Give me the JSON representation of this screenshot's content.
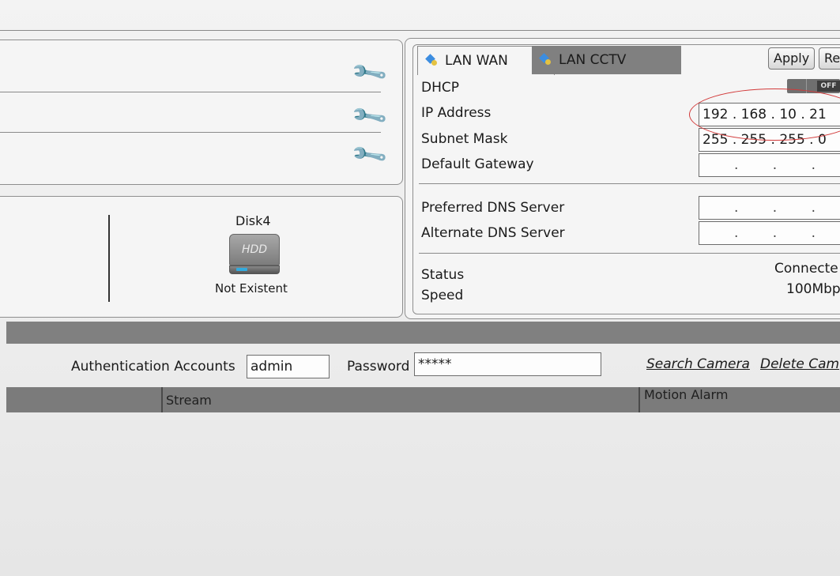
{
  "network": {
    "tabs": [
      {
        "label": "LAN WAN",
        "active": true
      },
      {
        "label": "LAN CCTV",
        "active": false
      }
    ],
    "buttons": {
      "apply": "Apply",
      "reset": "Re"
    },
    "dhcp": {
      "label": "DHCP",
      "state": "OFF"
    },
    "ip_address": {
      "label": "IP Address",
      "value": "192 . 168 . 10 . 21"
    },
    "subnet_mask": {
      "label": "Subnet Mask",
      "value": "255 . 255 . 255 . 0"
    },
    "default_gateway": {
      "label": "Default Gateway",
      "value": ". . ."
    },
    "preferred_dns": {
      "label": "Preferred DNS Server",
      "value": ". . ."
    },
    "alternate_dns": {
      "label": "Alternate DNS Server",
      "value": ". . ."
    },
    "status": {
      "label": "Status",
      "value": "Connecte"
    },
    "speed": {
      "label": "Speed",
      "value": "100Mbp"
    }
  },
  "disk": {
    "name": "Disk4",
    "icon_text": "HDD",
    "status": "Not Existent"
  },
  "camera": {
    "auth_label": "Authentication Accounts",
    "auth_value": "admin",
    "password_label": "Password",
    "password_value": "*****",
    "search_link": "Search Camera",
    "delete_link": "Delete Cam"
  },
  "table": {
    "columns": [
      "Stream",
      "Motion Alarm"
    ]
  },
  "colors": {
    "highlight_circle": "#d23a3a",
    "tab_icon": "#3c8de0"
  }
}
